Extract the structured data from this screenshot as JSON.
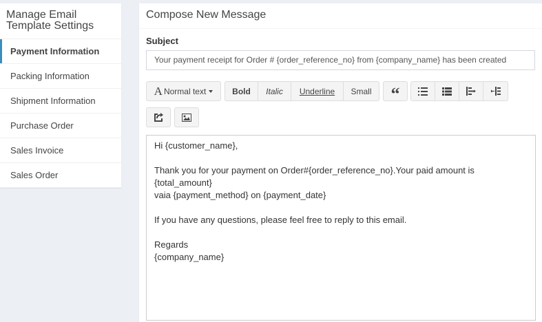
{
  "sidebar": {
    "title": "Manage Email Template Settings",
    "items": [
      {
        "label": "Payment Information",
        "active": true
      },
      {
        "label": "Packing Information"
      },
      {
        "label": "Shipment Information"
      },
      {
        "label": "Purchase Order"
      },
      {
        "label": "Sales Invoice"
      },
      {
        "label": "Sales Order"
      }
    ]
  },
  "compose": {
    "header": "Compose New Message",
    "subject_label": "Subject",
    "subject_value": "Your payment receipt for Order # {order_reference_no} from {company_name} has been created"
  },
  "toolbar": {
    "font_letter": "A",
    "text_style_label": "Normal text",
    "bold_label": "Bold",
    "italic_label": "Italic",
    "underline_label": "Underline",
    "small_label": "Small",
    "icons": [
      "quote-icon",
      "unordered-list-icon",
      "ordered-list-icon",
      "outdent-icon",
      "indent-icon",
      "link-icon",
      "image-icon"
    ]
  },
  "body": {
    "greeting": "Hi {customer_name},",
    "line1": "Thank you for your payment on Order#{order_reference_no}.Your paid amount is {total_amount}",
    "line2": "vaia {payment_method} on {payment_date}",
    "line3": "If you have any questions, please feel free to reply to this email.",
    "sign_off": "Regards",
    "signature": "{company_name}"
  },
  "colors": {
    "accent": "#3c8dbc",
    "background": "#ecf0f5"
  }
}
